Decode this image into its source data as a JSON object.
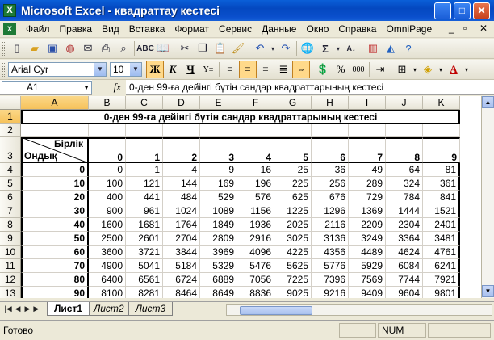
{
  "window": {
    "title": "Microsoft Excel - квадраттау кестесі",
    "app_icon": "excel-app-icon",
    "controls": [
      "minimize-icon",
      "maximize-icon",
      "close-icon"
    ]
  },
  "menu": {
    "items": [
      "Файл",
      "Правка",
      "Вид",
      "Вставка",
      "Формат",
      "Сервис",
      "Данные",
      "Окно",
      "Справка",
      "OmniPage"
    ]
  },
  "toolbar_standard": {
    "icons": [
      "new-icon",
      "open-icon",
      "save-icon",
      "permission-icon",
      "email-icon",
      "print-icon",
      "print-preview-icon",
      "spelling-icon",
      "research-icon",
      "cut-icon",
      "copy-icon",
      "paste-icon",
      "format-painter-icon",
      "undo-icon",
      "redo-icon",
      "hyperlink-icon",
      "autosum-icon",
      "sort-ascending-icon",
      "chart-wizard-icon",
      "drawing-icon",
      "help-icon"
    ]
  },
  "toolbar_format": {
    "font": "Arial Cyr",
    "size": "10",
    "bold": "Ж",
    "italic": "К",
    "underline": "Ч",
    "active": [
      "bold",
      "align-center"
    ]
  },
  "formula_bar": {
    "name_box": "A1",
    "fx": "fx",
    "content": "0-ден 99-ға дейінгі бүтін сандар квадраттарының кестесі"
  },
  "sheet": {
    "columns": [
      "A",
      "B",
      "C",
      "D",
      "E",
      "F",
      "G",
      "H",
      "I",
      "J",
      "K"
    ],
    "rows": [
      "1",
      "2",
      "3",
      "4",
      "5",
      "6",
      "7",
      "8",
      "9",
      "10",
      "11",
      "12",
      "13"
    ],
    "title": "0-ден 99-ға дейінгі бүтін сандар квадраттарының кестесі",
    "corner_top": "Бірлік",
    "corner_bottom": "Ондық",
    "units": [
      "0",
      "1",
      "2",
      "3",
      "4",
      "5",
      "6",
      "7",
      "8",
      "9"
    ],
    "tens": [
      "0",
      "10",
      "20",
      "30",
      "40",
      "50",
      "60",
      "70",
      "80",
      "90"
    ],
    "values": [
      [
        "0",
        "1",
        "4",
        "9",
        "16",
        "25",
        "36",
        "49",
        "64",
        "81"
      ],
      [
        "100",
        "121",
        "144",
        "169",
        "196",
        "225",
        "256",
        "289",
        "324",
        "361"
      ],
      [
        "400",
        "441",
        "484",
        "529",
        "576",
        "625",
        "676",
        "729",
        "784",
        "841"
      ],
      [
        "900",
        "961",
        "1024",
        "1089",
        "1156",
        "1225",
        "1296",
        "1369",
        "1444",
        "1521"
      ],
      [
        "1600",
        "1681",
        "1764",
        "1849",
        "1936",
        "2025",
        "2116",
        "2209",
        "2304",
        "2401"
      ],
      [
        "2500",
        "2601",
        "2704",
        "2809",
        "2916",
        "3025",
        "3136",
        "3249",
        "3364",
        "3481"
      ],
      [
        "3600",
        "3721",
        "3844",
        "3969",
        "4096",
        "4225",
        "4356",
        "4489",
        "4624",
        "4761"
      ],
      [
        "4900",
        "5041",
        "5184",
        "5329",
        "5476",
        "5625",
        "5776",
        "5929",
        "6084",
        "6241"
      ],
      [
        "6400",
        "6561",
        "6724",
        "6889",
        "7056",
        "7225",
        "7396",
        "7569",
        "7744",
        "7921"
      ],
      [
        "8100",
        "8281",
        "8464",
        "8649",
        "8836",
        "9025",
        "9216",
        "9409",
        "9604",
        "9801"
      ]
    ]
  },
  "tabs": {
    "sheets": [
      "Лист1",
      "Лист2",
      "Лист3"
    ],
    "active": "Лист1"
  },
  "status": {
    "left": "Готово",
    "num": "NUM"
  }
}
